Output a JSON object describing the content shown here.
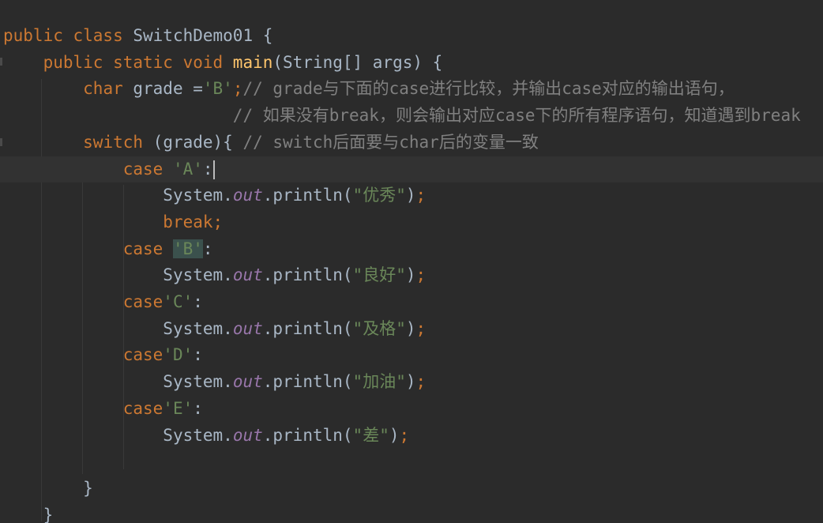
{
  "editor": {
    "lines": [
      {
        "indent": "",
        "tokens": [
          {
            "t": "kw",
            "v": "public class "
          },
          {
            "t": "plain",
            "v": "SwitchDemo01 {"
          }
        ]
      },
      {
        "indent": "    ",
        "tokens": [
          {
            "t": "kw",
            "v": "public static void "
          },
          {
            "t": "fn",
            "v": "main"
          },
          {
            "t": "plain",
            "v": "(String[] args) {"
          }
        ]
      },
      {
        "indent": "        ",
        "tokens": [
          {
            "t": "kw",
            "v": "char "
          },
          {
            "t": "plain",
            "v": "grade ="
          },
          {
            "t": "str",
            "v": "'B'"
          },
          {
            "t": "kw",
            "v": ";"
          },
          {
            "t": "cmt",
            "v": "// grade与下面的case进行比较，并输出case对应的输出语句，"
          }
        ]
      },
      {
        "indent": "                       ",
        "tokens": [
          {
            "t": "cmt",
            "v": "// 如果没有break，则会输出对应case下的所有程序语句，知道遇到break"
          }
        ]
      },
      {
        "indent": "        ",
        "tokens": [
          {
            "t": "kw",
            "v": "switch "
          },
          {
            "t": "plain",
            "v": "(grade){ "
          },
          {
            "t": "cmt",
            "v": "// switch后面要与char后的变量一致"
          }
        ]
      },
      {
        "indent": "            ",
        "caret": true,
        "tokens": [
          {
            "t": "kw",
            "v": "case "
          },
          {
            "t": "str",
            "v": "'A'"
          },
          {
            "t": "plain",
            "v": ":"
          }
        ]
      },
      {
        "indent": "                ",
        "tokens": [
          {
            "t": "plain",
            "v": "System."
          },
          {
            "t": "fld",
            "v": "out"
          },
          {
            "t": "plain",
            "v": ".println("
          },
          {
            "t": "str",
            "v": "\"优秀\""
          },
          {
            "t": "plain",
            "v": ")"
          },
          {
            "t": "kw",
            "v": ";"
          }
        ]
      },
      {
        "indent": "                ",
        "tokens": [
          {
            "t": "kw",
            "v": "break;"
          }
        ]
      },
      {
        "indent": "            ",
        "tokens": [
          {
            "t": "kw",
            "v": "case "
          },
          {
            "t": "str-match",
            "v": "'B'"
          },
          {
            "t": "plain",
            "v": ":"
          }
        ]
      },
      {
        "indent": "                ",
        "tokens": [
          {
            "t": "plain",
            "v": "System."
          },
          {
            "t": "fld",
            "v": "out"
          },
          {
            "t": "plain",
            "v": ".println("
          },
          {
            "t": "str",
            "v": "\"良好\""
          },
          {
            "t": "plain",
            "v": ")"
          },
          {
            "t": "kw",
            "v": ";"
          }
        ]
      },
      {
        "indent": "            ",
        "tokens": [
          {
            "t": "kw",
            "v": "case"
          },
          {
            "t": "str",
            "v": "'C'"
          },
          {
            "t": "plain",
            "v": ":"
          }
        ]
      },
      {
        "indent": "                ",
        "tokens": [
          {
            "t": "plain",
            "v": "System."
          },
          {
            "t": "fld",
            "v": "out"
          },
          {
            "t": "plain",
            "v": ".println("
          },
          {
            "t": "str",
            "v": "\"及格\""
          },
          {
            "t": "plain",
            "v": ")"
          },
          {
            "t": "kw",
            "v": ";"
          }
        ]
      },
      {
        "indent": "            ",
        "tokens": [
          {
            "t": "kw",
            "v": "case"
          },
          {
            "t": "str",
            "v": "'D'"
          },
          {
            "t": "plain",
            "v": ":"
          }
        ]
      },
      {
        "indent": "                ",
        "tokens": [
          {
            "t": "plain",
            "v": "System."
          },
          {
            "t": "fld",
            "v": "out"
          },
          {
            "t": "plain",
            "v": ".println("
          },
          {
            "t": "str",
            "v": "\"加油\""
          },
          {
            "t": "plain",
            "v": ")"
          },
          {
            "t": "kw",
            "v": ";"
          }
        ]
      },
      {
        "indent": "            ",
        "tokens": [
          {
            "t": "kw",
            "v": "case"
          },
          {
            "t": "str",
            "v": "'E'"
          },
          {
            "t": "plain",
            "v": ":"
          }
        ]
      },
      {
        "indent": "                ",
        "tokens": [
          {
            "t": "plain",
            "v": "System."
          },
          {
            "t": "fld",
            "v": "out"
          },
          {
            "t": "plain",
            "v": ".println("
          },
          {
            "t": "str",
            "v": "\"差\""
          },
          {
            "t": "plain",
            "v": ")"
          },
          {
            "t": "kw",
            "v": ";"
          }
        ]
      },
      {
        "indent": "",
        "tokens": []
      },
      {
        "indent": "        ",
        "tokens": [
          {
            "t": "plain",
            "v": "}"
          }
        ]
      },
      {
        "indent": "    ",
        "tokens": [
          {
            "t": "plain",
            "v": "}"
          }
        ]
      }
    ]
  },
  "colors": {
    "background": "#2b2b2b",
    "keyword": "#cc7832",
    "method": "#ffc66d",
    "string": "#6a8759",
    "comment": "#808080",
    "field": "#9876aa",
    "text": "#a9b7c6"
  }
}
